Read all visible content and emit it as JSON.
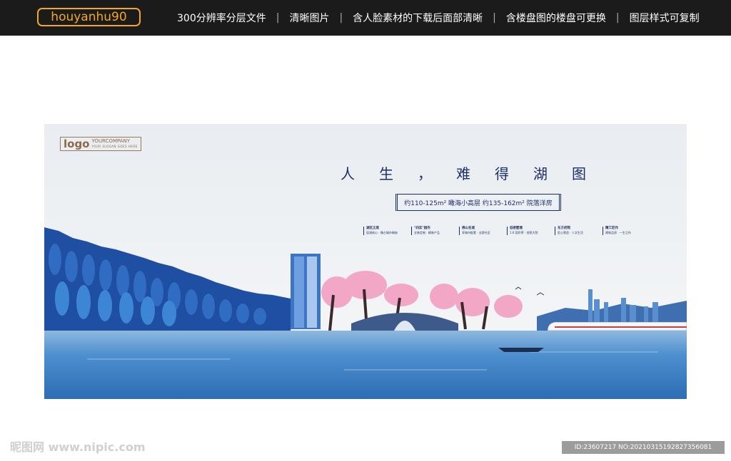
{
  "topbar": {
    "brand": "houyanhu90",
    "nav": [
      "300分辨率分层文件",
      "清晰图片",
      "含人脸素材的下载后面部清晰",
      "含楼盘图的楼盘可更换",
      "图层样式可复制"
    ],
    "separator": "|"
  },
  "poster": {
    "logo": {
      "mark": "logo",
      "company": "YOURCOMPANY",
      "slogan": "YOUR SLOGAN GOES HERE"
    },
    "headline": "人生，难得湖图",
    "scroll_text": "约110-125m² 瞰海小高层 约135-162m² 院落洋房",
    "features": [
      {
        "title": "湖区正席",
        "desc": "居湖核心 · 臻占城市稀缺"
      },
      {
        "title": "\"四实\"园作",
        "desc": "全装定制 · 精装产品"
      },
      {
        "title": "佛山名城",
        "desc": "享城市配套 · 全龄社区"
      },
      {
        "title": "低密墅境",
        "desc": "1.6 容积率 · 低密大院"
      },
      {
        "title": "东方府院",
        "desc": "匠心营造 · 人文生活"
      },
      {
        "title": "精工匠作",
        "desc": "建筑品质 · 一生之作"
      }
    ],
    "colors": {
      "sky": "#eef1f4",
      "lake": "#3a7fc4",
      "forest": "#1e4fa3",
      "blossom": "#f2a7c6",
      "ink": "#1d2f6b"
    }
  },
  "footer": {
    "watermark": "昵图网 www.nipic.com",
    "id_text": "ID:23607217 NO:20210315192827356081"
  }
}
